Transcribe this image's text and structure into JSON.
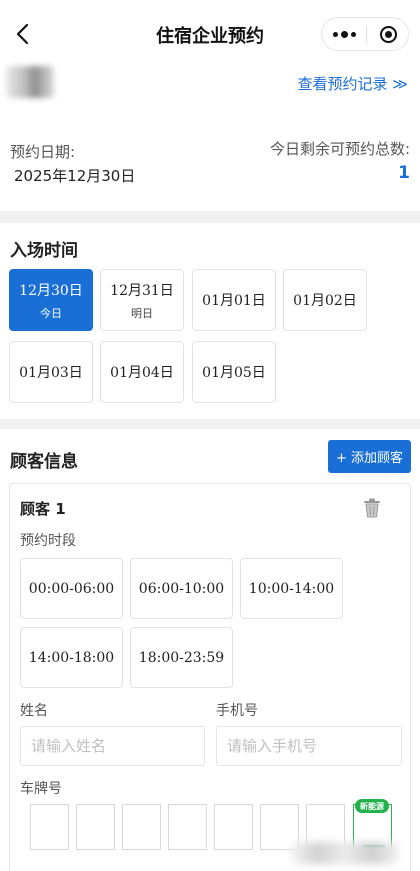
{
  "nav": {
    "title": "住宿企业预约"
  },
  "header": {
    "records_link": "查看预约记录 ≫"
  },
  "booking_info": {
    "date_label": "预约日期:",
    "date_value": "2025年12月30日",
    "remain_label": "今日剩余可预约总数:",
    "remain_value": "1"
  },
  "entry_time": {
    "title": "入场时间",
    "dates": [
      {
        "date": "12月30日",
        "sub": "今日",
        "selected": true
      },
      {
        "date": "12月31日",
        "sub": "明日",
        "selected": false
      },
      {
        "date": "01月01日",
        "sub": "",
        "selected": false
      },
      {
        "date": "01月02日",
        "sub": "",
        "selected": false
      },
      {
        "date": "01月03日",
        "sub": "",
        "selected": false
      },
      {
        "date": "01月04日",
        "sub": "",
        "selected": false
      },
      {
        "date": "01月05日",
        "sub": "",
        "selected": false
      }
    ]
  },
  "guests": {
    "title": "顾客信息",
    "add_button": "+ 添加顾客",
    "guest": {
      "title": "顾客 1",
      "slot_label": "预约时段",
      "slots": [
        "00:00-06:00",
        "06:00-10:00",
        "10:00-14:00",
        "14:00-18:00",
        "18:00-23:59"
      ],
      "name_label": "姓名",
      "name_placeholder": "请输入姓名",
      "phone_label": "手机号",
      "phone_placeholder": "请输入手机号",
      "plate_label": "车牌号",
      "new_energy_badge": "新能源"
    }
  },
  "colors": {
    "accent": "#1a6fd6",
    "new_energy": "#22b14c",
    "separator": "#f2f2f2"
  }
}
